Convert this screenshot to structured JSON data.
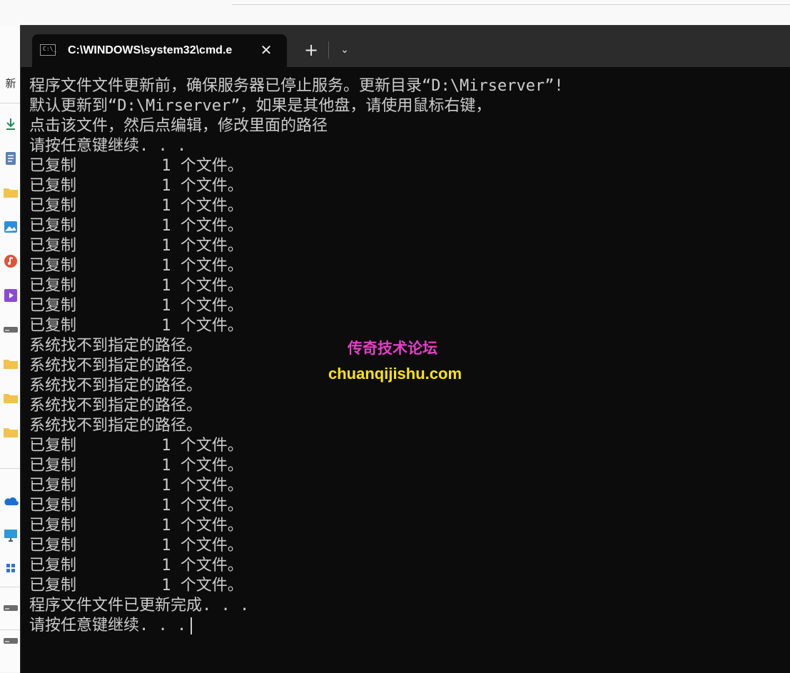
{
  "window": {
    "tab_title": "C:\\WINDOWS\\system32\\cmd.e",
    "close_glyph": "✕",
    "new_tab_glyph": "+",
    "dropdown_glyph": "⌄",
    "icon_text": "C:\\_"
  },
  "background_explorer": {
    "left_label": "新"
  },
  "console_lines": [
    "程序文件文件更新前，确保服务器已停止服务。更新目录“D:\\Mirserver”!",
    "默认更新到“D:\\Mirserver”，如果是其他盘，请使用鼠标右键，",
    "点击该文件，然后点编辑，修改里面的路径",
    "请按任意键继续. . .",
    "已复制         1 个文件。",
    "已复制         1 个文件。",
    "已复制         1 个文件。",
    "已复制         1 个文件。",
    "已复制         1 个文件。",
    "已复制         1 个文件。",
    "已复制         1 个文件。",
    "已复制         1 个文件。",
    "已复制         1 个文件。",
    "系统找不到指定的路径。",
    "系统找不到指定的路径。",
    "系统找不到指定的路径。",
    "系统找不到指定的路径。",
    "系统找不到指定的路径。",
    "已复制         1 个文件。",
    "已复制         1 个文件。",
    "已复制         1 个文件。",
    "已复制         1 个文件。",
    "已复制         1 个文件。",
    "已复制         1 个文件。",
    "已复制         1 个文件。",
    "已复制         1 个文件。",
    "程序文件文件已更新完成. . .",
    "请按任意键继续. . ."
  ],
  "watermark": {
    "cn": "传奇技术论坛",
    "url": "chuanqijishu.com",
    "cn_color": "#e53ec6",
    "url_color": "#ffe600"
  },
  "colors": {
    "console_bg": "#0c0c0c",
    "console_text": "#cccccc",
    "titlebar_bg": "#2c2c2c"
  }
}
